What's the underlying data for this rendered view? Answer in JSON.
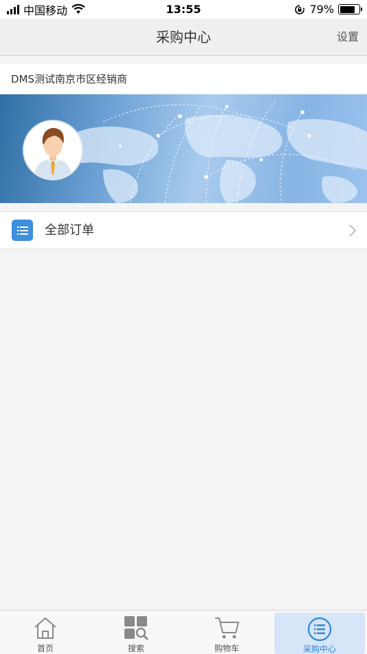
{
  "status_bar": {
    "carrier": "中国移动",
    "time": "13:55",
    "battery_percent_text": "79%",
    "battery_level": 0.79
  },
  "nav": {
    "title": "采购中心",
    "settings_label": "设置"
  },
  "dealer": {
    "name": "DMS测试南京市区经销商"
  },
  "menu": {
    "all_orders_label": "全部订单"
  },
  "tabs": [
    {
      "label": "首页",
      "icon": "home-icon",
      "active": false
    },
    {
      "label": "搜索",
      "icon": "search-grid-icon",
      "active": false
    },
    {
      "label": "购物车",
      "icon": "cart-icon",
      "active": false
    },
    {
      "label": "采购中心",
      "icon": "list-circle-icon",
      "active": true
    }
  ],
  "colors": {
    "accent": "#2f84d8",
    "orders_icon_bg": "#3e8fdc",
    "active_tab_bg": "#d6e6f8"
  }
}
